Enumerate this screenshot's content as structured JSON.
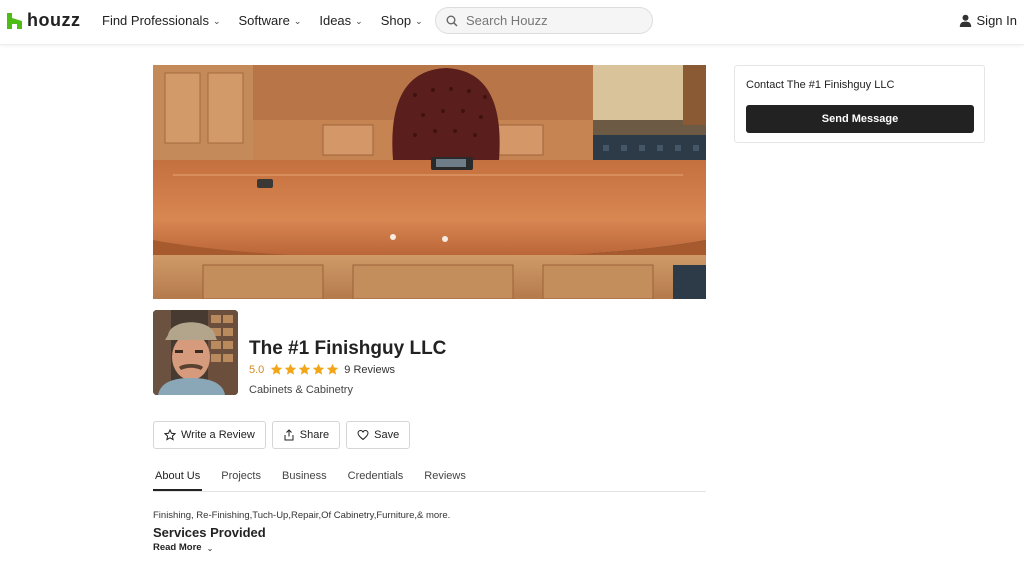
{
  "header": {
    "logo_text": "houzz",
    "nav": [
      {
        "label": "Find Professionals"
      },
      {
        "label": "Software"
      },
      {
        "label": "Ideas"
      },
      {
        "label": "Shop"
      }
    ],
    "search_placeholder": "Search Houzz",
    "sign_in": "Sign In"
  },
  "contact": {
    "title": "Contact The #1 Finishguy LLC",
    "send_label": "Send Message"
  },
  "profile": {
    "name": "The #1 Finishguy LLC",
    "rating": "5.0",
    "stars_filled": 5,
    "reviews": "9 Reviews",
    "category": "Cabinets & Cabinetry"
  },
  "actions": {
    "write_review": "Write a Review",
    "share": "Share",
    "save": "Save"
  },
  "tabs": [
    {
      "label": "About Us",
      "active": true
    },
    {
      "label": "Projects"
    },
    {
      "label": "Business"
    },
    {
      "label": "Credentials"
    },
    {
      "label": "Reviews"
    }
  ],
  "about": {
    "description": "Finishing, Re-Finishing,Tuch-Up,Repair,Of Cabinetry,Furniture,& more.",
    "services_title": "Services Provided",
    "read_more": "Read More"
  },
  "colors": {
    "brand_green": "#4dbc15",
    "star_gold": "#f2a71b",
    "rating_text": "#d38c21",
    "dark_button": "#222222"
  },
  "icons": {
    "search": "search-icon",
    "user": "user-icon",
    "star": "star-icon",
    "share": "share-icon",
    "heart": "heart-icon",
    "chevron": "chevron-down-icon"
  }
}
